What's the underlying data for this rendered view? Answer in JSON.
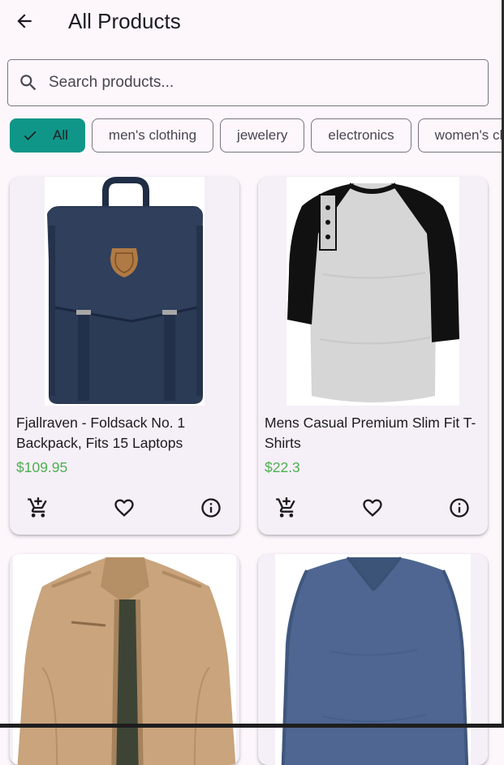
{
  "app_bar": {
    "title": "All Products",
    "back_icon": "arrow-back-icon"
  },
  "search": {
    "placeholder": "Search products...",
    "value": "",
    "icon": "search-icon"
  },
  "categories": [
    {
      "label": "All",
      "selected": true
    },
    {
      "label": "men's clothing",
      "selected": false
    },
    {
      "label": "jewelery",
      "selected": false
    },
    {
      "label": "electronics",
      "selected": false
    },
    {
      "label": "women's clothing",
      "selected": false
    }
  ],
  "colors": {
    "accent": "#109688",
    "price": "#4caf50",
    "background": "#fdf7fc",
    "card": "#f5eff7"
  },
  "products": [
    {
      "title": "Fjallraven - Foldsack No. 1 Backpack, Fits 15 Laptops",
      "price": "$109.95",
      "image": "navy-backpack"
    },
    {
      "title": "Mens Casual Premium Slim Fit T-Shirts",
      "price": "$22.3",
      "image": "grey-black-raglan-henley-shirt"
    },
    {
      "title": "",
      "price": "",
      "image": "khaki-cotton-jacket"
    },
    {
      "title": "",
      "price": "",
      "image": "blue-long-sleeve-v-neck-shirt"
    }
  ],
  "card_actions": {
    "cart_icon": "add-shopping-cart-icon",
    "favorite_icon": "favorite-border-icon",
    "info_icon": "info-outline-icon"
  }
}
